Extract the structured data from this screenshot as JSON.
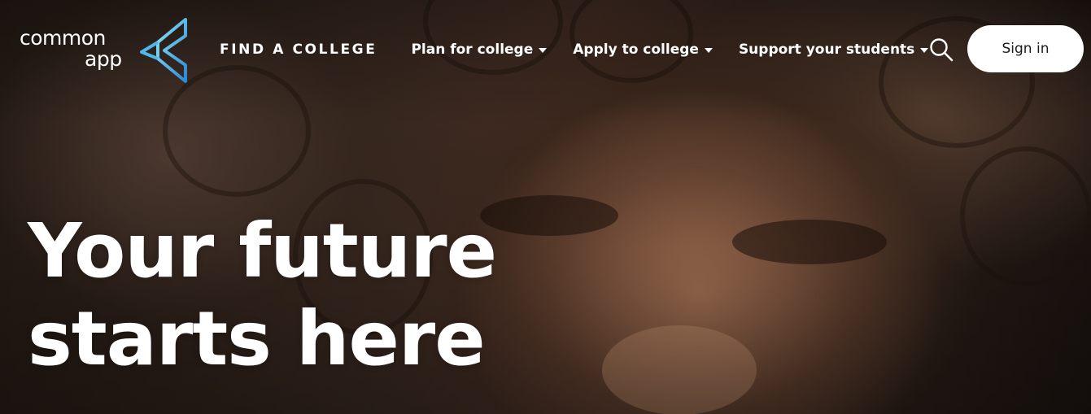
{
  "header": {
    "logo": {
      "line1": "common",
      "line2": "app",
      "icon": "common-app-logo-mark"
    },
    "nav": {
      "find_college": "FIND A COLLEGE",
      "items": [
        {
          "label": "Plan for college",
          "icon": "caret-down-icon"
        },
        {
          "label": "Apply to college",
          "icon": "caret-down-icon"
        },
        {
          "label": "Support your students",
          "icon": "caret-down-icon"
        }
      ]
    },
    "search_icon": "search-icon",
    "signin_label": "Sign in"
  },
  "hero": {
    "headline_line1": "Your future",
    "headline_line2": "starts here"
  },
  "colors": {
    "logo_accent_light": "#7fd8f5",
    "logo_accent_dark": "#2b8fd9",
    "text": "#ffffff",
    "button_bg": "#ffffff",
    "button_text": "#1a1a1a"
  }
}
